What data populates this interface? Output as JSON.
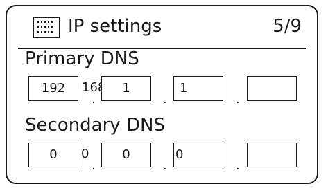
{
  "title": {
    "icon": "grid-dots-icon",
    "text": "IP settings",
    "page_indicator": "5/9"
  },
  "primary_dns": {
    "label": "Primary DNS",
    "octets": [
      "192",
      "",
      "1",
      "1",
      ""
    ],
    "overflow_text": "168"
  },
  "secondary_dns": {
    "label": "Secondary DNS",
    "octets": [
      "0",
      "",
      "0",
      "0",
      ""
    ],
    "overflow_1": "0",
    "overflow_2": "0"
  },
  "separator": "."
}
